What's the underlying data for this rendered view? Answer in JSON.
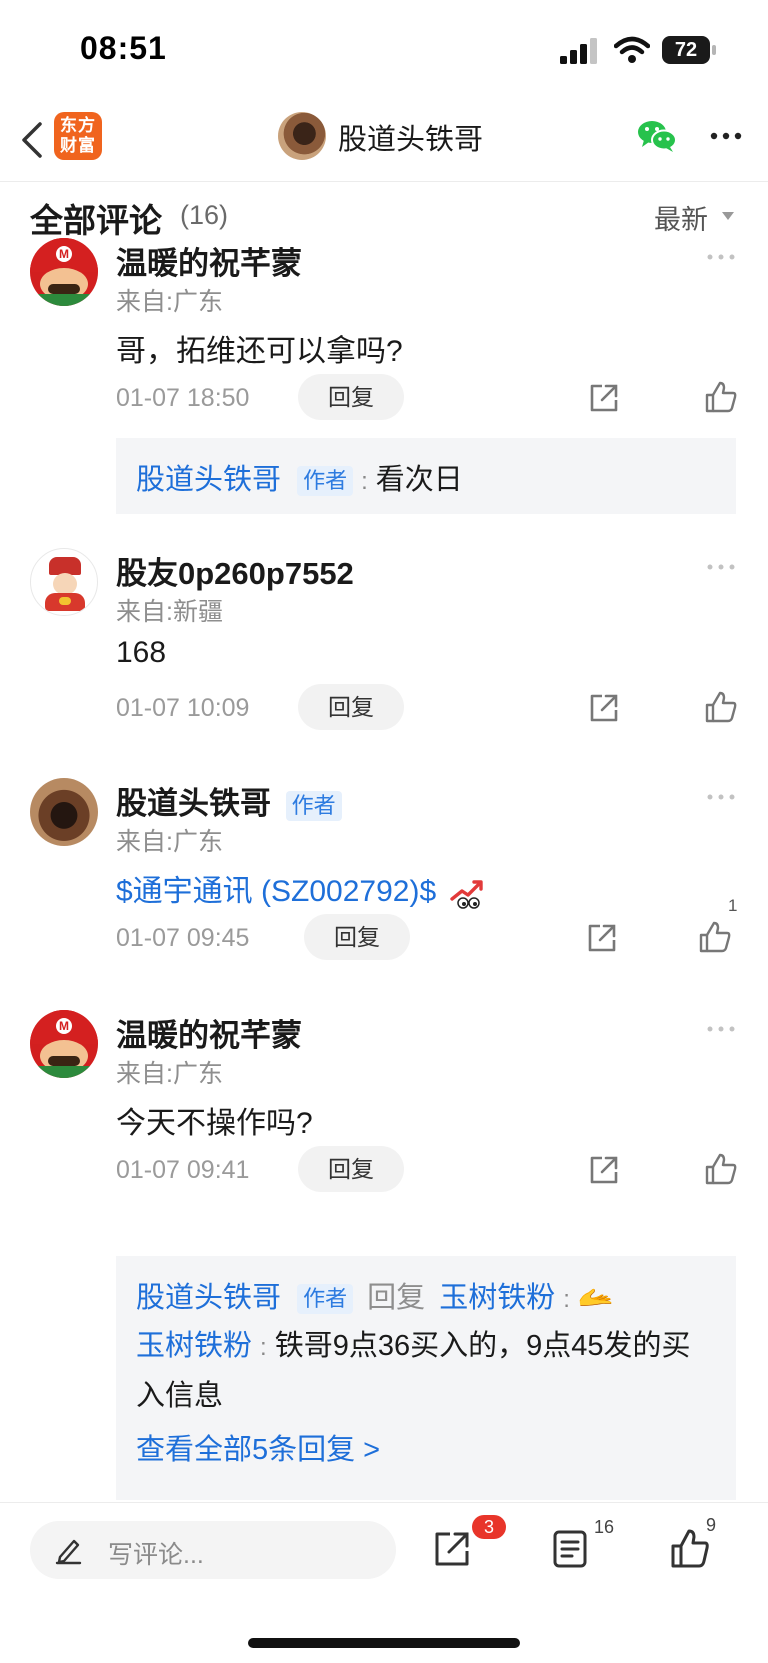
{
  "status_bar": {
    "time": "08:51",
    "battery": "72"
  },
  "nav": {
    "app_logo_text": "东方财富",
    "title": "股道头铁哥"
  },
  "comments_header": {
    "title": "全部评论",
    "count": "(16)",
    "sort": "最新"
  },
  "author_badge": "作者",
  "reply_button_label": "回复",
  "comments": [
    {
      "username": "温暖的祝芊蒙",
      "location": "来自:广东",
      "content": "哥，拓维还可以拿吗?",
      "time": "01-07 18:50",
      "likes": "",
      "replies": [
        {
          "name": "股道头铁哥",
          "badge": "作者",
          "text": "看次日"
        }
      ]
    },
    {
      "username": "股友0p260p7552",
      "location": "来自:新疆",
      "content": "168",
      "time": "01-07 10:09",
      "likes": ""
    },
    {
      "username": "股道头铁哥",
      "badge": "作者",
      "location": "来自:广东",
      "content": "$通宇通讯 (SZ002792)$",
      "time": "01-07 09:45",
      "likes": "1"
    },
    {
      "username": "温暖的祝芊蒙",
      "location": "来自:广东",
      "content": "今天不操作吗?",
      "time": "01-07 09:41",
      "likes": "",
      "replies": [
        {
          "name": "股道头铁哥",
          "badge": "作者",
          "reply_word": "回复",
          "target": "玉树铁粉",
          "text": "🫴"
        },
        {
          "name": "玉树铁粉",
          "text": "铁哥9点36买入的，9点45发的买入信息"
        }
      ],
      "view_all": "查看全部5条回复 >"
    }
  ],
  "bottom_bar": {
    "placeholder": "写评论...",
    "share_badge": "3",
    "comment_count": "16",
    "like_count": "9"
  },
  "colors": {
    "link_blue": "#1e6fd9",
    "brand_orange": "#f0641e",
    "badge_red": "#e8352a"
  }
}
